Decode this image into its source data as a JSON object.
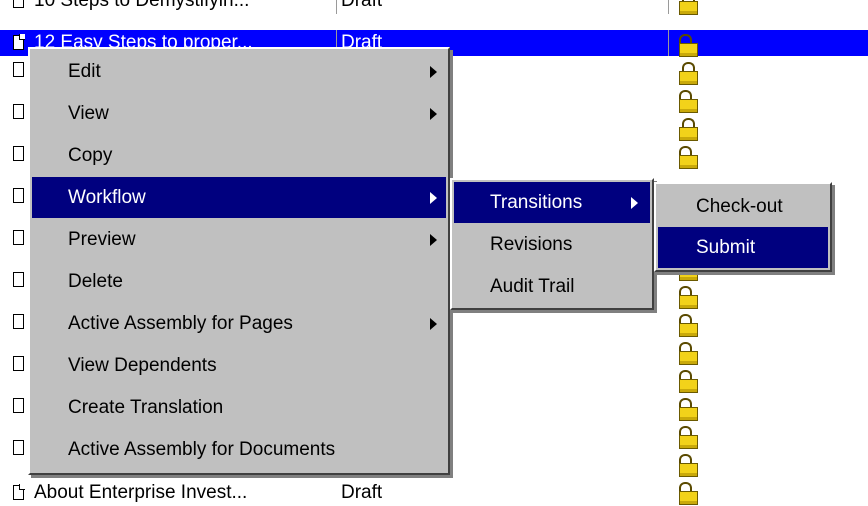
{
  "documents": [
    {
      "title": "10 Steps to Demystifyin...",
      "status": "Draft"
    },
    {
      "title": "12 Easy Steps to proper...",
      "status": "Draft"
    },
    {
      "title": "About Enterprise Invest...",
      "status": "Draft"
    }
  ],
  "context_menu": {
    "items": [
      {
        "label": "Edit",
        "submenu": true
      },
      {
        "label": "View",
        "submenu": true
      },
      {
        "label": "Copy",
        "submenu": false
      },
      {
        "label": "Workflow",
        "submenu": true
      },
      {
        "label": "Preview",
        "submenu": true
      },
      {
        "label": "Delete",
        "submenu": false
      },
      {
        "label": "Active Assembly for Pages",
        "submenu": true
      },
      {
        "label": "View Dependents",
        "submenu": false
      },
      {
        "label": "Create Translation",
        "submenu": false
      },
      {
        "label": "Active Assembly for Documents",
        "submenu": false
      }
    ]
  },
  "workflow_menu": {
    "items": [
      {
        "label": "Transitions",
        "submenu": true
      },
      {
        "label": "Revisions",
        "submenu": false
      },
      {
        "label": "Audit Trail",
        "submenu": false
      }
    ]
  },
  "transitions_menu": {
    "items": [
      {
        "label": "Check-out"
      },
      {
        "label": "Submit"
      }
    ]
  },
  "colors": {
    "selection": "#0000ff",
    "menu_highlight": "#00007f",
    "menu_face": "#c0c0c0",
    "lock": "#f2d21a"
  },
  "icons": {
    "document": "document-icon",
    "lock": "lock-icon",
    "submenu": "submenu-arrow-icon"
  }
}
